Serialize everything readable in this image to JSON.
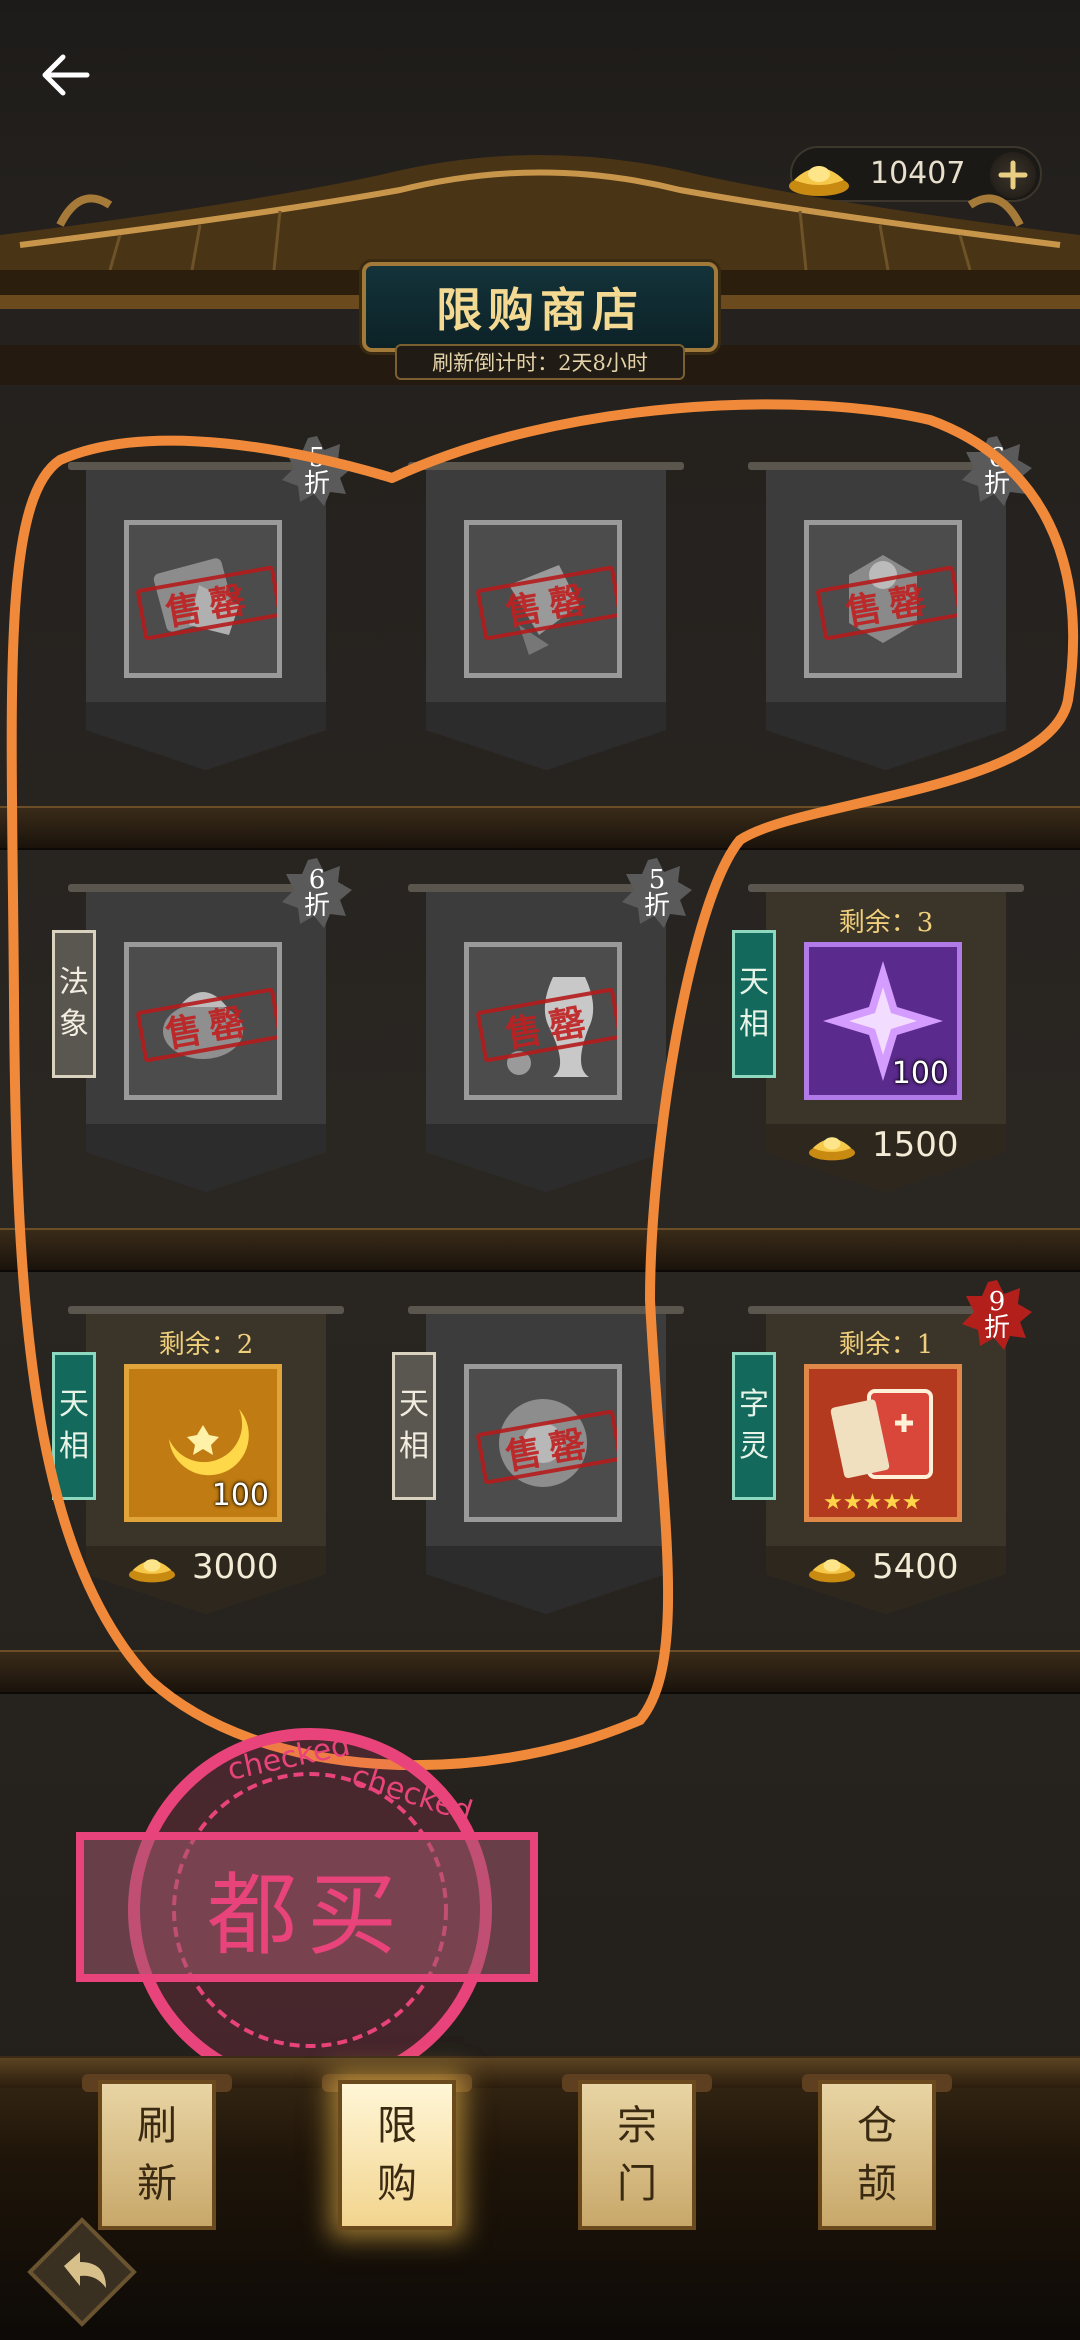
{
  "topbar": {
    "back_icon": "arrow-left-icon"
  },
  "currency": {
    "icon": "gold-ingot-icon",
    "amount": "10407",
    "add_icon": "plus-icon"
  },
  "header": {
    "title": "限购商店",
    "countdown": "刷新倒计时：2天8小时"
  },
  "items": [
    {
      "id": "r1c1",
      "status": "售罄",
      "discount": [
        "5",
        "折"
      ],
      "tag": null
    },
    {
      "id": "r1c2",
      "status": "售罄",
      "discount": null,
      "tag": null
    },
    {
      "id": "r1c3",
      "status": "售罄",
      "discount": [
        "6",
        "折"
      ],
      "tag": null
    },
    {
      "id": "r2c1",
      "status": "售罄",
      "discount": [
        "6",
        "折"
      ],
      "tag": [
        "法",
        "象"
      ]
    },
    {
      "id": "r2c2",
      "status": "售罄",
      "discount": [
        "5",
        "折"
      ],
      "tag": null
    },
    {
      "id": "r2c3",
      "remaining": "剩余：3",
      "tag": [
        "天",
        "相"
      ],
      "quantity": "100",
      "price": "1500",
      "icon": "purple-star-crystal-icon"
    },
    {
      "id": "r3c1",
      "remaining": "剩余：2",
      "tag": [
        "天",
        "相"
      ],
      "quantity": "100",
      "price": "3000",
      "icon": "gold-crescent-icon"
    },
    {
      "id": "r3c2",
      "status": "售罄",
      "discount": null,
      "tag": [
        "天",
        "相"
      ]
    },
    {
      "id": "r3c3",
      "remaining": "剩余：1",
      "tag": [
        "字",
        "灵"
      ],
      "discount": [
        "9",
        "折"
      ],
      "price": "5400",
      "icon": "red-book-icon",
      "stars": "★★★★★"
    }
  ],
  "annotation": {
    "stamp_text": "checked",
    "label": "都买"
  },
  "tabs": [
    {
      "label": [
        "刷",
        "新"
      ],
      "active": false
    },
    {
      "label": [
        "限",
        "购"
      ],
      "active": true
    },
    {
      "label": [
        "宗",
        "门"
      ],
      "active": false
    },
    {
      "label": [
        "仓",
        "颉"
      ],
      "active": false
    }
  ],
  "colors": {
    "highlight_stroke": "#f08a3a",
    "stamp_pink": "#e8437a",
    "sold_out_red": "#b51c1c",
    "gold": "#f4d992"
  }
}
